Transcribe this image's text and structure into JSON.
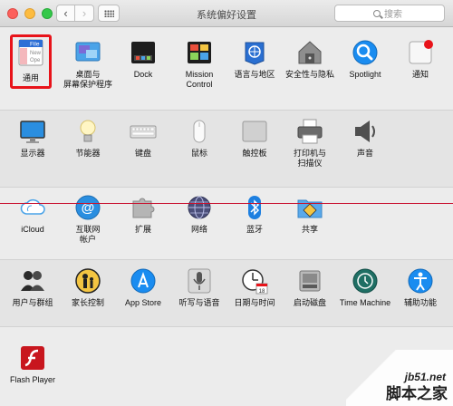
{
  "window": {
    "title": "系统偏好设置"
  },
  "search": {
    "placeholder": "搜索"
  },
  "rows": [
    [
      {
        "id": "general",
        "label": "通用",
        "label2": "",
        "icon": "general-icon"
      },
      {
        "id": "desktop",
        "label": "桌面与",
        "label2": "屏幕保护程序",
        "icon": "desktop-icon"
      },
      {
        "id": "dock",
        "label": "Dock",
        "label2": "",
        "icon": "dock-icon"
      },
      {
        "id": "mission",
        "label": "Mission",
        "label2": "Control",
        "icon": "mission-control-icon"
      },
      {
        "id": "language",
        "label": "语言与地区",
        "label2": "",
        "icon": "language-icon"
      },
      {
        "id": "security",
        "label": "安全性与隐私",
        "label2": "",
        "icon": "security-icon"
      },
      {
        "id": "spotlight",
        "label": "Spotlight",
        "label2": "",
        "icon": "spotlight-icon"
      },
      {
        "id": "notifications",
        "label": "通知",
        "label2": "",
        "icon": "notifications-icon"
      }
    ],
    [
      {
        "id": "displays",
        "label": "显示器",
        "label2": "",
        "icon": "display-icon"
      },
      {
        "id": "energy",
        "label": "节能器",
        "label2": "",
        "icon": "bulb-icon"
      },
      {
        "id": "keyboard",
        "label": "键盘",
        "label2": "",
        "icon": "keyboard-icon"
      },
      {
        "id": "mouse",
        "label": "鼠标",
        "label2": "",
        "icon": "mouse-icon"
      },
      {
        "id": "trackpad",
        "label": "触控板",
        "label2": "",
        "icon": "trackpad-icon"
      },
      {
        "id": "printers",
        "label": "打印机与",
        "label2": "扫描仪",
        "icon": "printer-icon"
      },
      {
        "id": "sound",
        "label": "声音",
        "label2": "",
        "icon": "speaker-icon"
      }
    ],
    [
      {
        "id": "icloud",
        "label": "iCloud",
        "label2": "",
        "icon": "cloud-icon"
      },
      {
        "id": "internet",
        "label": "互联网",
        "label2": "帐户",
        "icon": "at-icon"
      },
      {
        "id": "extensions",
        "label": "扩展",
        "label2": "",
        "icon": "puzzle-icon"
      },
      {
        "id": "network",
        "label": "网络",
        "label2": "",
        "icon": "globe-icon"
      },
      {
        "id": "bluetooth",
        "label": "蓝牙",
        "label2": "",
        "icon": "bluetooth-icon"
      },
      {
        "id": "sharing",
        "label": "共享",
        "label2": "",
        "icon": "sharing-folder-icon"
      }
    ],
    [
      {
        "id": "users",
        "label": "用户与群组",
        "label2": "",
        "icon": "users-icon"
      },
      {
        "id": "parental",
        "label": "家长控制",
        "label2": "",
        "icon": "parental-icon"
      },
      {
        "id": "appstore",
        "label": "App Store",
        "label2": "",
        "icon": "appstore-icon"
      },
      {
        "id": "dictation",
        "label": "听写与语音",
        "label2": "",
        "icon": "microphone-icon"
      },
      {
        "id": "datetime",
        "label": "日期与时间",
        "label2": "",
        "icon": "clock-icon"
      },
      {
        "id": "startup",
        "label": "启动磁盘",
        "label2": "",
        "icon": "disk-icon"
      },
      {
        "id": "timemachine",
        "label": "Time Machine",
        "label2": "",
        "icon": "time-machine-icon"
      },
      {
        "id": "accessibility",
        "label": "辅助功能",
        "label2": "",
        "icon": "accessibility-icon"
      }
    ],
    [
      {
        "id": "flash",
        "label": "Flash Player",
        "label2": "",
        "icon": "flash-icon"
      }
    ]
  ],
  "general_icon_text": [
    "File",
    "New",
    "Ope"
  ],
  "calendar_day": "18",
  "watermark": {
    "site": "jb51.net",
    "name": "脚本之家"
  },
  "colors": {
    "highlight": "#e8131a",
    "accent": "#1a8cf0"
  }
}
